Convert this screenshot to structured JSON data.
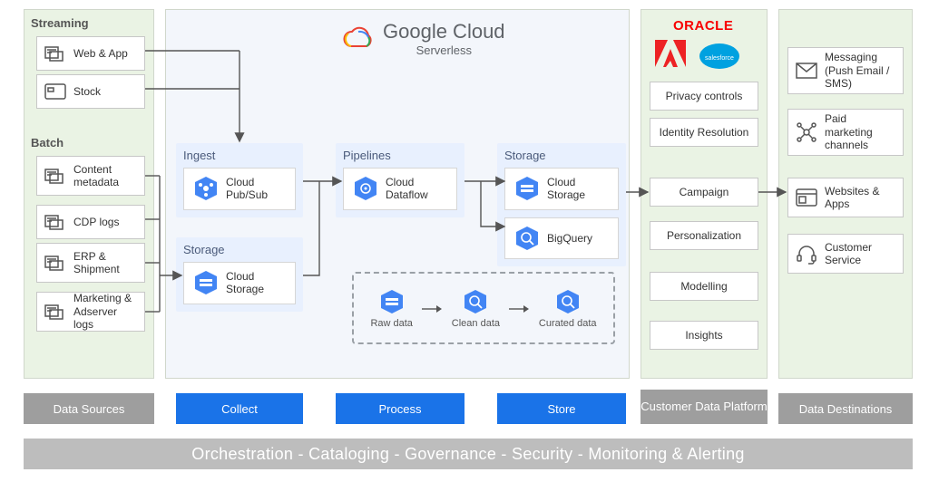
{
  "brand": {
    "line1": "Google Cloud",
    "line2": "Serverless"
  },
  "sources": {
    "streaming_title": "Streaming",
    "batch_title": "Batch",
    "streaming": [
      {
        "label": "Web & App"
      },
      {
        "label": "Stock"
      }
    ],
    "batch": [
      {
        "label": "Content metadata"
      },
      {
        "label": "CDP logs"
      },
      {
        "label": "ERP & Shipment"
      },
      {
        "label": "Marketing & Adserver logs"
      }
    ]
  },
  "collect": {
    "ingest_title": "Ingest",
    "storage_title": "Storage",
    "pubsub": "Cloud Pub/Sub",
    "gcs": "Cloud Storage"
  },
  "process": {
    "pipelines_title": "Pipelines",
    "dataflow": "Cloud Dataflow"
  },
  "store": {
    "storage_title": "Storage",
    "gcs": "Cloud Storage",
    "bq": "BigQuery"
  },
  "stages": {
    "s1": "Raw data",
    "s2": "Clean data",
    "s3": "Curated data"
  },
  "cdp": {
    "brands": {
      "oracle": "ORACLE"
    },
    "items": [
      "Privacy controls",
      "Identity Resolution",
      "Campaign",
      "Personalization",
      "Modelling",
      "Insights"
    ]
  },
  "destinations": [
    "Messaging (Push Email / SMS)",
    "Paid marketing channels",
    "Websites & Apps",
    "Customer Service"
  ],
  "bars": {
    "data_sources": "Data Sources",
    "collect": "Collect",
    "process": "Process",
    "store": "Store",
    "cdp": "Customer Data Platform",
    "dest": "Data Destinations",
    "footer": "Orchestration - Cataloging - Governance - Security - Monitoring & Alerting"
  }
}
